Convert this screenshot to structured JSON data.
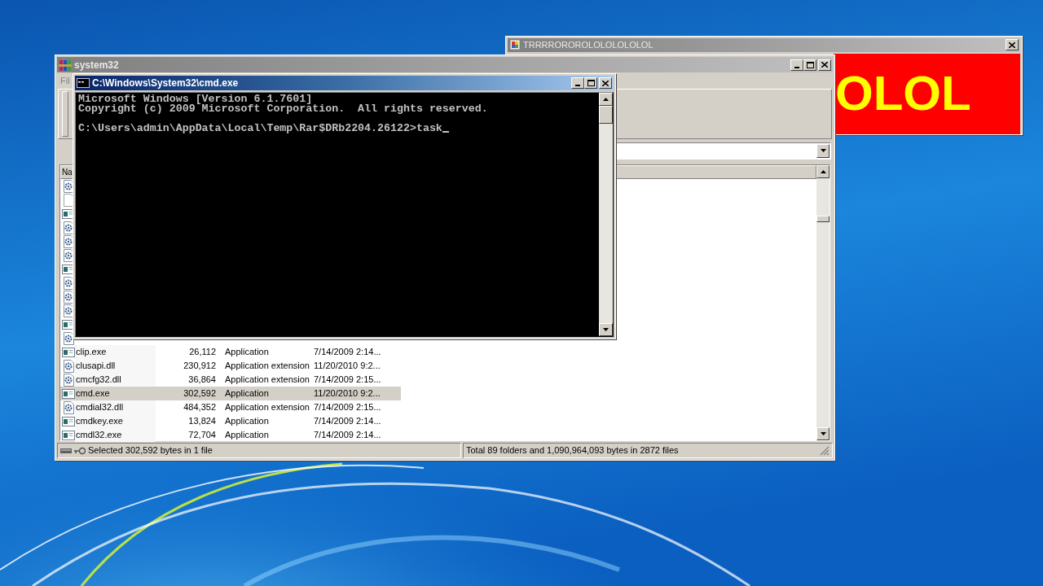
{
  "popup_window": {
    "title": "TRRRROROROLOLOLOLOLOL",
    "banner": "OLOL"
  },
  "archiver_window": {
    "title": "system32",
    "menu": [
      "Fil"
    ],
    "list": {
      "columns": [
        "Na"
      ],
      "covered_rows": [
        {
          "kind": "dll"
        },
        {
          "kind": "blank"
        },
        {
          "kind": "exe"
        },
        {
          "kind": "dll"
        },
        {
          "kind": "dll"
        },
        {
          "kind": "dll"
        },
        {
          "kind": "exe"
        },
        {
          "kind": "dll"
        },
        {
          "kind": "dll"
        },
        {
          "kind": "dll"
        },
        {
          "kind": "exe"
        },
        {
          "kind": "dll"
        }
      ],
      "rows": [
        {
          "kind": "exe",
          "name": "clip.exe",
          "size": "26,112",
          "type": "Application",
          "modified": "7/14/2009 2:14...",
          "selected": false
        },
        {
          "kind": "dll",
          "name": "clusapi.dll",
          "size": "230,912",
          "type": "Application extension",
          "modified": "11/20/2010 9:2...",
          "selected": false
        },
        {
          "kind": "dll",
          "name": "cmcfg32.dll",
          "size": "36,864",
          "type": "Application extension",
          "modified": "7/14/2009 2:15...",
          "selected": false
        },
        {
          "kind": "exe",
          "name": "cmd.exe",
          "size": "302,592",
          "type": "Application",
          "modified": "11/20/2010 9:2...",
          "selected": true
        },
        {
          "kind": "dll",
          "name": "cmdial32.dll",
          "size": "484,352",
          "type": "Application extension",
          "modified": "7/14/2009 2:15...",
          "selected": false
        },
        {
          "kind": "exe",
          "name": "cmdkey.exe",
          "size": "13,824",
          "type": "Application",
          "modified": "7/14/2009 2:14...",
          "selected": false
        },
        {
          "kind": "exe",
          "name": "cmdl32.exe",
          "size": "72,704",
          "type": "Application",
          "modified": "7/14/2009 2:14...",
          "selected": false
        }
      ]
    },
    "status_left": "Selected 302,592 bytes in 1 file",
    "status_right": "Total 89 folders and 1,090,964,093 bytes in 2872 files"
  },
  "console_window": {
    "title": "C:\\Windows\\System32\\cmd.exe",
    "header_lines": [
      "Microsoft Windows [Version 6.1.7601]",
      "Copyright (c) 2009 Microsoft Corporation.  All rights reserved."
    ],
    "prompt": "C:\\Users\\admin\\AppData\\Local\\Temp\\Rar$DRb2204.26122>task"
  }
}
